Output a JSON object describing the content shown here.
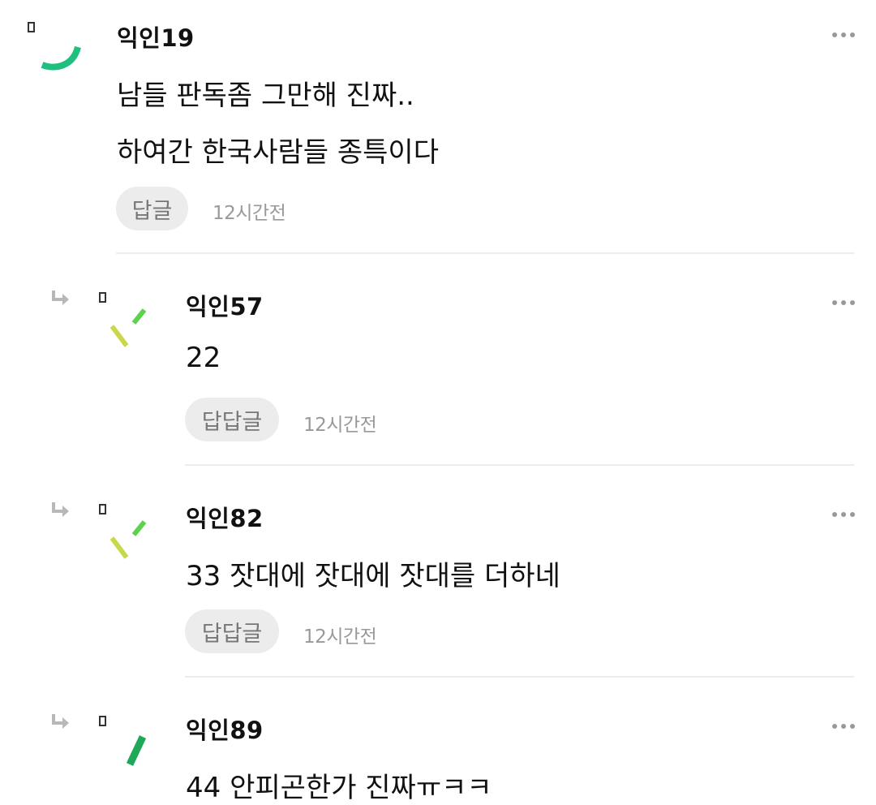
{
  "comments": [
    {
      "author": "익인19",
      "lines": [
        "남들 판독좀 그만해 진짜..",
        "하여간 한국사람들 종특이다"
      ],
      "reply_label": "답글",
      "time": "12시간전"
    },
    {
      "author": "익인57",
      "lines": [
        "22"
      ],
      "reply_label": "답답글",
      "time": "12시간전"
    },
    {
      "author": "익인82",
      "lines": [
        "33 잣대에 잣대에 잣대를 더하네"
      ],
      "reply_label": "답답글",
      "time": "12시간전"
    },
    {
      "author": "익인89",
      "lines": [
        "44 안피곤한가 진짜ㅠㅋㅋ"
      ]
    }
  ],
  "icons": {
    "more": "more-dots-icon",
    "reply_arrow": "reply-arrow-icon",
    "badge": "badge-square-icon",
    "avatar": "avatar-icon"
  },
  "colors": {
    "avatar_green": "#1fbf7e",
    "avatar_yellow": "#c8d84a",
    "avatar_lime": "#5ed14f",
    "avatar_green_dark": "#1ea85a",
    "pill_bg": "#ececec",
    "time_text": "#999999"
  }
}
